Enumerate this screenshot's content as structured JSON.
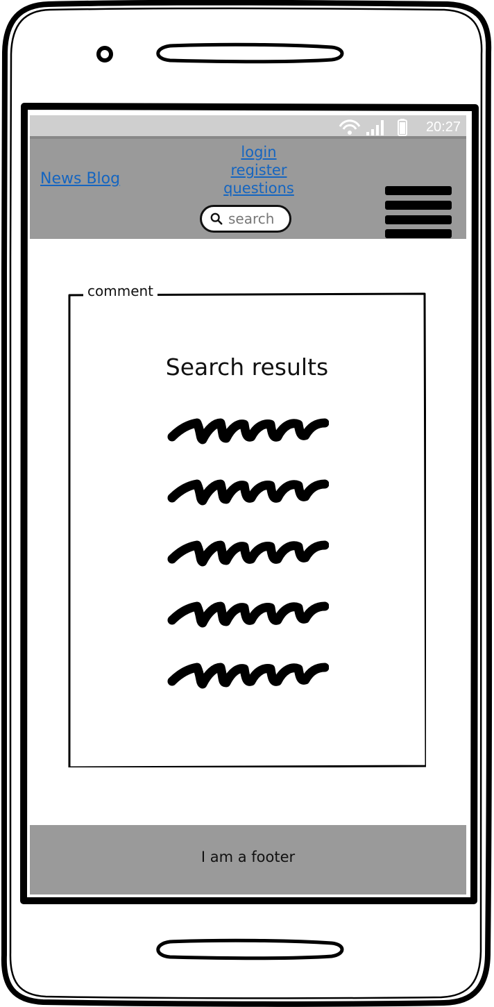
{
  "status_bar": {
    "time": "20:27",
    "icons": [
      "wifi-icon",
      "signal-icon",
      "battery-icon"
    ]
  },
  "header": {
    "brand": "News Blog",
    "nav": {
      "login": "login",
      "register": "register",
      "questions": "questions"
    },
    "search": {
      "placeholder": "search",
      "icon": "search-icon"
    },
    "menu_icon": "hamburger-menu-icon"
  },
  "main": {
    "group_label": "comment",
    "title": "Search results",
    "result_count": 5
  },
  "footer": {
    "text": "I am a footer"
  },
  "colors": {
    "header_bg": "#9a9a9a",
    "statusbar_bg": "#cfcfcf",
    "link": "#1565c0",
    "footer_bg": "#9a9a9a"
  }
}
